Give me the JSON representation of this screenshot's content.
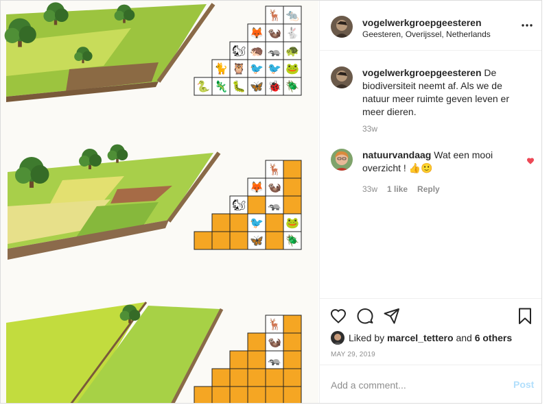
{
  "post": {
    "username": "vogelwerkgroepgeesteren",
    "location": "Geesteren, Overijssel, Netherlands"
  },
  "caption": {
    "username": "vogelwerkgroepgeesteren",
    "text": "De biodiversiteit neemt af. Als we de natuur meer ruimte geven leven er meer dieren.",
    "time": "33w"
  },
  "comments": [
    {
      "username": "natuurvandaag",
      "text": "Wat een mooi overzicht ! 👍🙂",
      "time": "33w",
      "likes": "1 like",
      "reply": "Reply"
    }
  ],
  "likes": {
    "prefix": "Liked by",
    "user": "marcel_tettero",
    "joiner": "and",
    "others": "6 others"
  },
  "date": "MAY 29, 2019",
  "add_comment": {
    "placeholder": "Add a comment...",
    "post_label": "Post"
  },
  "icons": {
    "more": "more-options-icon",
    "like": "heart-icon",
    "comment": "comment-bubble-icon",
    "share": "paper-plane-icon",
    "save": "bookmark-icon",
    "comment_like": "heart-filled-icon"
  },
  "colors": {
    "like_red": "#ed4956",
    "post_disabled": "#b2dffc",
    "muted": "#8e8e8e",
    "grid_orange": "#f5a623"
  },
  "illustration": {
    "panels": [
      {
        "name": "high-biodiversity",
        "cells": 24,
        "orange_cells": 0
      },
      {
        "name": "medium-biodiversity",
        "cells": 30,
        "orange_cells": 13
      },
      {
        "name": "low-biodiversity",
        "cells": 40,
        "orange_cells": 33
      }
    ]
  }
}
